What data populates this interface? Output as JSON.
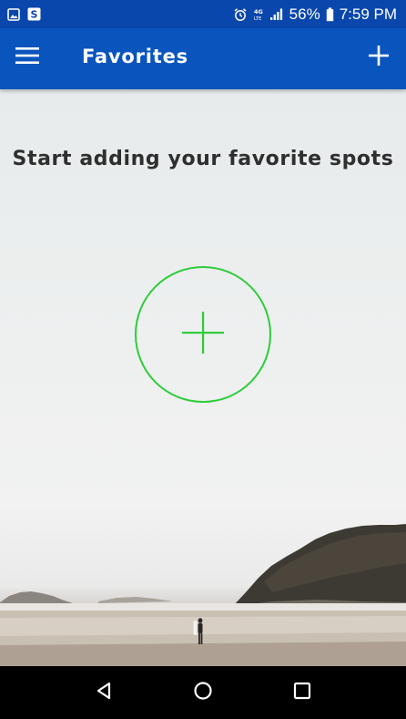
{
  "status_bar": {
    "battery_percent": "56%",
    "time": "7:59 PM",
    "icons": [
      "gallery-icon",
      "s-app-icon",
      "alarm-icon",
      "4g-lte-icon",
      "signal-icon",
      "battery-icon"
    ]
  },
  "app_bar": {
    "title": "Favorites",
    "menu_icon": "hamburger-menu-icon",
    "action_icon": "plus-icon"
  },
  "main": {
    "empty_message": "Start adding your favorite spots",
    "add_button_icon": "plus-icon",
    "accent_color": "#2ecc3a"
  },
  "nav_bar": {
    "icons": [
      "back-icon",
      "home-icon",
      "recent-apps-icon"
    ]
  },
  "colors": {
    "status_bar": "#0a47ad",
    "app_bar": "#0a54bd",
    "text": "#2f2f2f"
  }
}
